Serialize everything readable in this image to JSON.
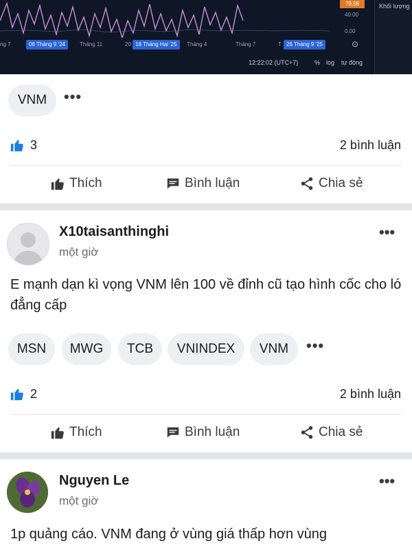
{
  "chart_header": {
    "price_tag": "79.58",
    "axis_values": [
      "40.00",
      "0.00"
    ],
    "panel_label": "Khối lượng",
    "dates": [
      "ng 7",
      "Tháng 11",
      "20",
      "Tháng 4",
      "Tháng 7",
      "T"
    ],
    "highlighted_dates": [
      "06 Tháng 9 '24",
      "18 Tháng Hai '25",
      "26 Tháng 9 '25"
    ],
    "time": "12:22:02 (UTC+7)",
    "options": [
      "%",
      "log",
      "tự động"
    ]
  },
  "post1": {
    "tags": [
      "VNM"
    ],
    "likes": "3",
    "comments": "2 bình luận",
    "actions": {
      "like": "Thích",
      "comment": "Bình luận",
      "share": "Chia sẻ"
    }
  },
  "post2": {
    "author": "X10taisanthinghi",
    "time": "một giờ",
    "text": "E mạnh dạn kì vọng VNM lên 100 về đỉnh cũ tạo hình cốc cho ló đẳng cấp",
    "tags": [
      "MSN",
      "MWG",
      "TCB",
      "VNINDEX",
      "VNM"
    ],
    "likes": "2",
    "comments": "2 bình luận",
    "actions": {
      "like": "Thích",
      "comment": "Bình luận",
      "share": "Chia sẻ"
    }
  },
  "post3": {
    "author": "Nguyen Le",
    "time": "một giờ",
    "text": "1p quảng cáo. VNM đang ở vùng giá thấp hơn vùng"
  },
  "icons": {
    "like": "thumbs-up-icon",
    "comment": "comment-bubble-icon",
    "share": "share-icon",
    "more": "more-dots-icon",
    "settings": "gear-icon"
  },
  "colors": {
    "accent": "#1d7fe0",
    "chart_bg": "#0f1626",
    "date_highlight": "#2b64d8",
    "price_tag": "#e07a2b"
  }
}
